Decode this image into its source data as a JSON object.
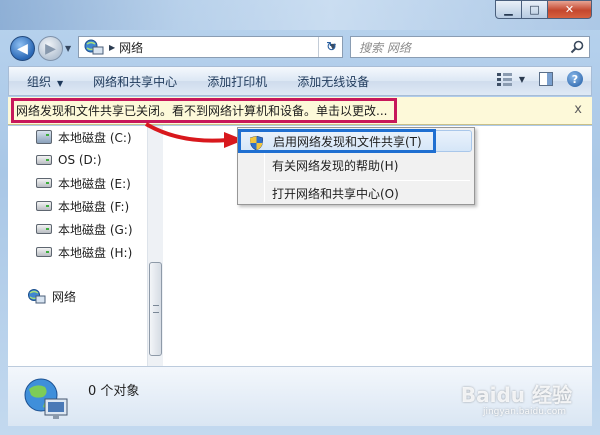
{
  "window": {
    "min_label": "▁",
    "max_label": "□",
    "close_label": "✕"
  },
  "nav": {
    "address_path": "网络",
    "search_placeholder": "搜索 网络"
  },
  "toolbar": {
    "organize": "组织",
    "network_center": "网络和共享中心",
    "add_printer": "添加打印机",
    "add_wireless": "添加无线设备",
    "help": "?"
  },
  "infobar": {
    "text": "网络发现和文件共享已关闭。看不到网络计算机和设备。单击以更改...",
    "close": "x"
  },
  "nav_pane": {
    "drives": [
      {
        "label": "本地磁盘 (C:)"
      },
      {
        "label": "OS (D:)"
      },
      {
        "label": "本地磁盘 (E:)"
      },
      {
        "label": "本地磁盘 (F:)"
      },
      {
        "label": "本地磁盘 (G:)"
      },
      {
        "label": "本地磁盘 (H:)"
      }
    ],
    "network": "网络"
  },
  "context_menu": {
    "items": [
      {
        "label": "启用网络发现和文件共享(T)"
      },
      {
        "label": "有关网络发现的帮助(H)"
      },
      {
        "label": "打开网络和共享中心(O)"
      }
    ]
  },
  "details": {
    "count": "0 个对象"
  },
  "watermark": {
    "main": "Baidu 经验",
    "sub": "jingyan.baidu.com"
  },
  "colors": {
    "highlight_red": "#c7185b",
    "highlight_blue": "#1f6fd1",
    "arrow_red": "#d8181d"
  }
}
